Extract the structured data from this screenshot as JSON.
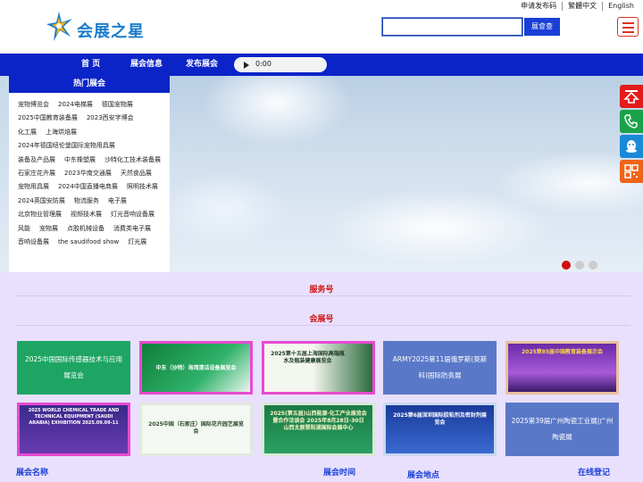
{
  "header": {
    "logo_text": "会展之星",
    "top_links": [
      "申请发布码",
      "繁體中文",
      "English"
    ],
    "search_placeholder": "",
    "search_button": "展會查"
  },
  "nav": {
    "items": [
      "首 页",
      "展会信息",
      "发布展会"
    ],
    "audio_time": "0:00"
  },
  "hot_fairs": {
    "title": "热门展会",
    "items": [
      "宠物博览会",
      "2024电梯展",
      "德国宠物展",
      "2025中国教育装备展",
      "2023西安字博会",
      "化工展",
      "上海烘焙展",
      "2024年德国纽伦堡国际宠物用具展",
      "装备及产品展",
      "中东橡塑展",
      "沙特化工技术装备展",
      "石家庄花卉展",
      "2023华南交通展",
      "天然食品展",
      "宠物用具展",
      "2024中国直播电商展",
      "照明技术展",
      "2024英国安防展",
      "物流服务",
      "电子展",
      "北京物业管理展",
      "视频技术展",
      "灯光音响设备展",
      "风能",
      "宠物展",
      "点胶机械设备",
      "消费类电子展",
      "音响设备展",
      "the saudifood show",
      "灯光展"
    ]
  },
  "carousel": {
    "slides": 3,
    "active": 1
  },
  "side_icons": [
    "top-icon",
    "phone-icon",
    "qq-icon",
    "qrcode-icon"
  ],
  "sections": {
    "service": "服务号",
    "fair": "会展号"
  },
  "cards": [
    {
      "type": "text",
      "title": "2025中国国际传感器技术与应用展览会",
      "color": "#1ea563"
    },
    {
      "type": "image",
      "caption": "中东（沙特）海湾清洁设备展览会",
      "color": "#0e7f3a"
    },
    {
      "type": "image",
      "caption": "2025第十五届上海国际高端瓶水及瓶装健康展览会",
      "color": "#2b6b3a"
    },
    {
      "type": "text",
      "title": "ARMY2025第11届俄罗斯(莫斯科)国际防务展",
      "color": "#5a78c8"
    },
    {
      "type": "image",
      "caption": "2025第85届中国教育装备展示会",
      "color": "#8a3ec0"
    },
    {
      "type": "image",
      "caption": "2025 WORLD CHEMICAL TRADE AND TECHNICAL EQUIPMENT (SAUDI ARABIA) EXHIBITION 2025.09.09-11",
      "color": "#3a2a8c"
    },
    {
      "type": "image",
      "caption": "2025中国（石家庄）国际花卉园艺展览会",
      "color": "#f4f8f2"
    },
    {
      "type": "image",
      "caption": "2025(第五届)山西能源·化工产业展览会暨合作洽谈会 2025年8月28日-30日 山西太原晋阳湖国际会展中心",
      "color": "#1b7a45"
    },
    {
      "type": "image",
      "caption": "2025第6届深圳国际胶粘剂及密封剂展览会",
      "color": "#2a4fb0"
    },
    {
      "type": "text",
      "title": "2025第39届广州陶瓷工业展|广州陶瓷展",
      "color": "#5a78c8"
    }
  ],
  "footer": [
    "展会名称",
    "展会时间",
    "展会地点",
    "在线登记"
  ]
}
